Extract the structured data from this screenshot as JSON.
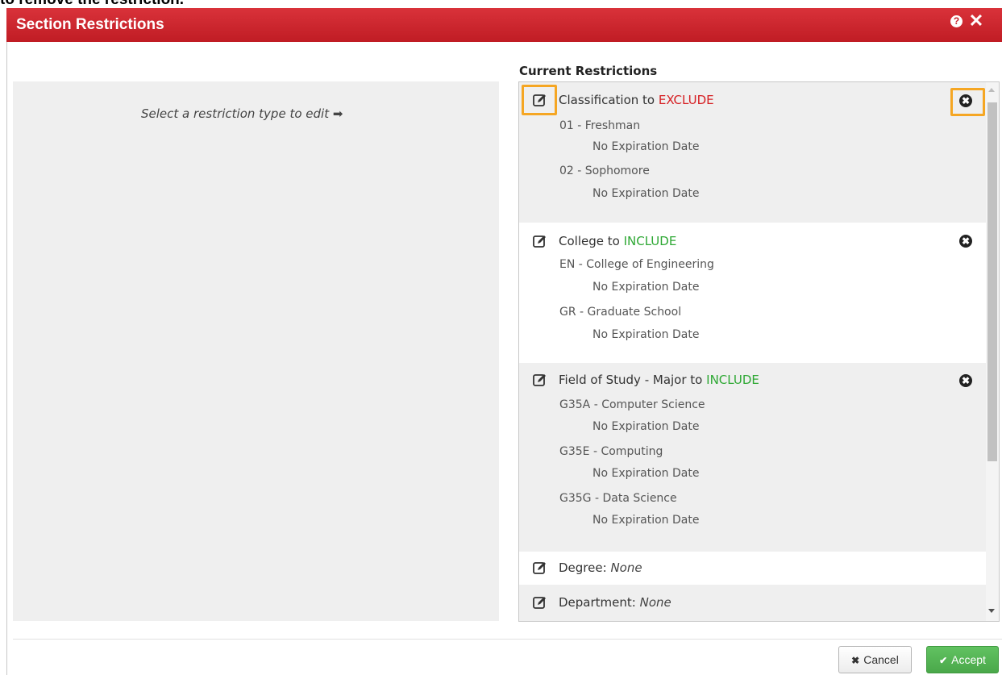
{
  "top_caption": "to remove the restriction.",
  "dialog": {
    "title": "Section Restrictions",
    "help_symbol": "?",
    "close_symbol": "✕"
  },
  "left_panel": {
    "hint": "Select a restriction type to edit",
    "hint_arrow": "➡"
  },
  "current": {
    "heading": "Current Restrictions",
    "classification": {
      "label": "Classification to",
      "keyword": "EXCLUDE",
      "items": [
        {
          "value": "01 - Freshman",
          "expiration": "No Expiration Date"
        },
        {
          "value": "02 - Sophomore",
          "expiration": "No Expiration Date"
        }
      ]
    },
    "college": {
      "label": "College to",
      "keyword": "INCLUDE",
      "items": [
        {
          "value": "EN - College of Engineering",
          "expiration": "No Expiration Date"
        },
        {
          "value": "GR - Graduate School",
          "expiration": "No Expiration Date"
        }
      ]
    },
    "major": {
      "label": "Field of Study - Major to",
      "keyword": "INCLUDE",
      "items": [
        {
          "value": "G35A - Computer Science",
          "expiration": "No Expiration Date"
        },
        {
          "value": "G35E - Computing",
          "expiration": "No Expiration Date"
        },
        {
          "value": "G35G - Data Science",
          "expiration": "No Expiration Date"
        }
      ]
    },
    "degree": {
      "label": "Degree:",
      "value": "None"
    },
    "department": {
      "label": "Department:",
      "value": "None"
    },
    "remove_symbol": "✖"
  },
  "footer": {
    "cancel_icon": "✖",
    "cancel_label": "Cancel",
    "accept_icon": "✔",
    "accept_label": "Accept"
  },
  "colors": {
    "title_bar": "#c8202a",
    "exclude": "#d62024",
    "include": "#2ea834",
    "highlight": "#f5a623",
    "accept": "#4aa84a"
  }
}
